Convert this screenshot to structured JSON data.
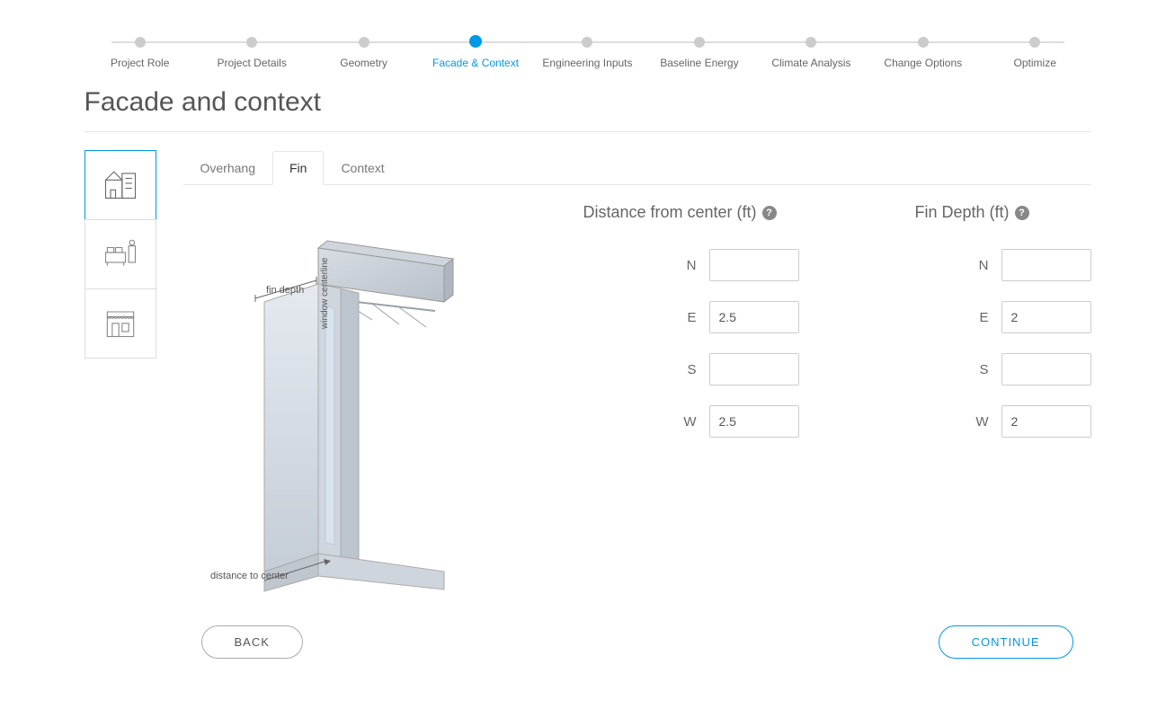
{
  "stepper": [
    {
      "label": "Project Role",
      "active": false
    },
    {
      "label": "Project Details",
      "active": false
    },
    {
      "label": "Geometry",
      "active": false
    },
    {
      "label": "Facade & Context",
      "active": true
    },
    {
      "label": "Engineering Inputs",
      "active": false
    },
    {
      "label": "Baseline Energy",
      "active": false
    },
    {
      "label": "Climate Analysis",
      "active": false
    },
    {
      "label": "Change Options",
      "active": false
    },
    {
      "label": "Optimize",
      "active": false
    }
  ],
  "page_title": "Facade and context",
  "tabs": [
    {
      "label": "Overhang",
      "active": false
    },
    {
      "label": "Fin",
      "active": true
    },
    {
      "label": "Context",
      "active": false
    }
  ],
  "diagram": {
    "label_fin_depth": "fin depth",
    "label_window_centerline": "window centerline",
    "label_distance_to_center": "distance to center"
  },
  "columns": {
    "distance": {
      "header": "Distance from center (ft)",
      "rows": [
        {
          "dir": "N",
          "value": ""
        },
        {
          "dir": "E",
          "value": "2.5"
        },
        {
          "dir": "S",
          "value": ""
        },
        {
          "dir": "W",
          "value": "2.5"
        }
      ]
    },
    "depth": {
      "header": "Fin Depth (ft)",
      "rows": [
        {
          "dir": "N",
          "value": ""
        },
        {
          "dir": "E",
          "value": "2"
        },
        {
          "dir": "S",
          "value": ""
        },
        {
          "dir": "W",
          "value": "2"
        }
      ]
    }
  },
  "buttons": {
    "back": "BACK",
    "continue": "CONTINUE"
  }
}
